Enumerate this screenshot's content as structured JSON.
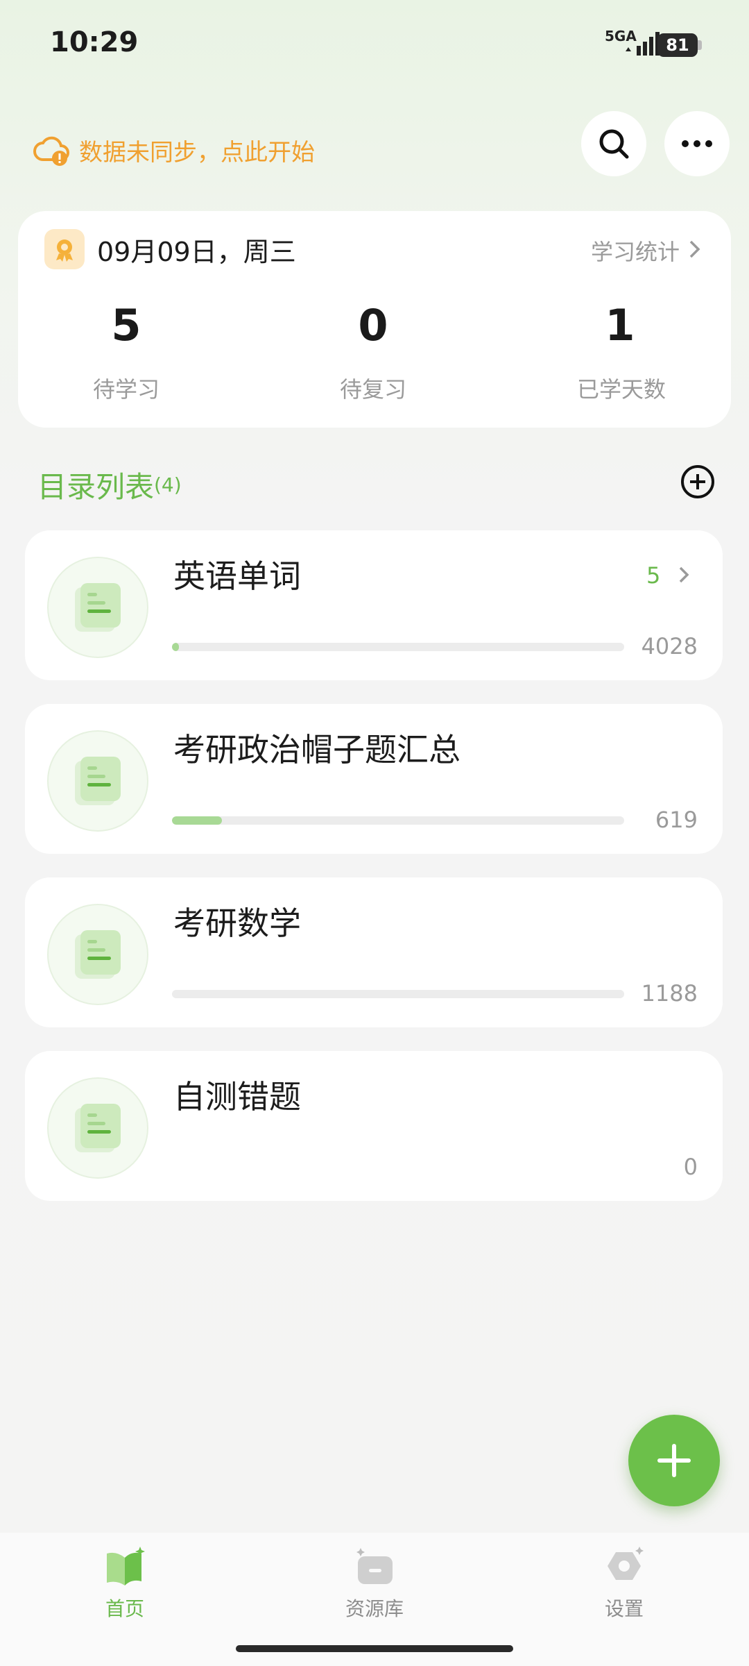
{
  "status_bar": {
    "time": "10:29",
    "network": "5GA",
    "battery": "81"
  },
  "sync": {
    "text": "数据未同步，点此开始"
  },
  "summary": {
    "date": "09月09日，周三",
    "stats_link": "学习统计",
    "stats": [
      {
        "value": "5",
        "label": "待学习"
      },
      {
        "value": "0",
        "label": "待复习"
      },
      {
        "value": "1",
        "label": "已学天数"
      }
    ]
  },
  "directory": {
    "title": "目录列表",
    "count": "(4)",
    "items": [
      {
        "title": "英语单词",
        "due": "5",
        "total": "4028",
        "progress": 0.01
      },
      {
        "title": "考研政治帽子题汇总",
        "due": "",
        "total": "619",
        "progress": 0.11
      },
      {
        "title": "考研数学",
        "due": "",
        "total": "1188",
        "progress": 0.0
      },
      {
        "title": "自测错题",
        "due": "",
        "total": "0",
        "progress": null
      }
    ]
  },
  "bottom_nav": {
    "items": [
      {
        "label": "首页",
        "icon": "home-book-icon",
        "active": true
      },
      {
        "label": "资源库",
        "icon": "resource-box-icon",
        "active": false
      },
      {
        "label": "设置",
        "icon": "settings-hex-icon",
        "active": false
      }
    ]
  },
  "colors": {
    "accent": "#6ab94c",
    "warning": "#f0a030",
    "fab": "#6cc04a"
  }
}
